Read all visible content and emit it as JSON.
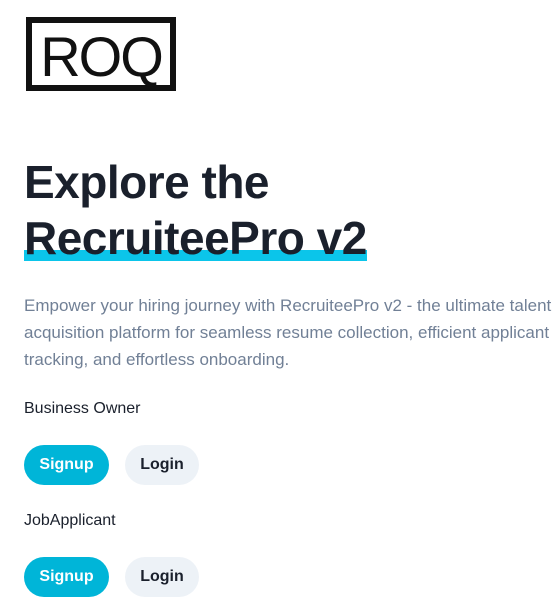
{
  "brand": {
    "logo_text": "ROQ",
    "logo_icon": "roq-logo"
  },
  "hero": {
    "title_line1": "Explore the",
    "title_line2": "RecruiteePro v2",
    "description": "Empower your hiring journey with RecruiteePro v2 - the ultimate talent acquisition platform for seamless resume collection, efficient applicant tracking, and effortless onboarding.",
    "accent_color": "#0bc5ea"
  },
  "roles": [
    {
      "label": "Business Owner",
      "signup_label": "Signup",
      "login_label": "Login"
    },
    {
      "label": "JobApplicant",
      "signup_label": "Signup",
      "login_label": "Login"
    }
  ],
  "colors": {
    "primary_button": "#00b5d8",
    "secondary_button": "#edf2f7",
    "heading": "#1a202c",
    "muted_text": "#718096"
  }
}
